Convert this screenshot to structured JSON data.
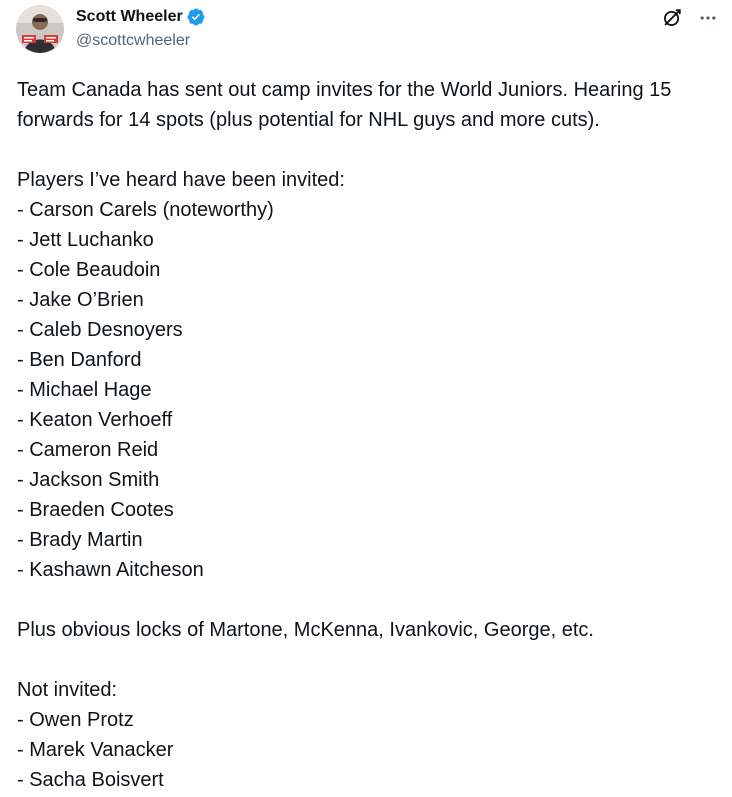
{
  "author": {
    "display_name": "Scott Wheeler",
    "handle": "@scottcwheeler",
    "verified": true,
    "avatar": "person-photo-avatar"
  },
  "actions": {
    "grok_icon": "slash-circle-icon",
    "more_icon": "more-horizontal-icon"
  },
  "colors": {
    "verified_badge": "#1d9bf0",
    "text_primary": "#0f1419",
    "text_secondary": "#536471"
  },
  "tweet": {
    "intro": [
      "Team Canada has sent out camp invites for the World Juniors. Hearing 15",
      "forwards for 14 spots (plus potential for NHL guys and more cuts)."
    ],
    "invited_heading": "Players I’ve heard have been invited:",
    "invited": [
      "- Carson Carels (noteworthy)",
      "- Jett Luchanko",
      "- Cole Beaudoin",
      "- Jake O’Brien",
      "- Caleb Desnoyers",
      "- Ben Danford",
      "- Michael Hage",
      "- Keaton Verhoeff",
      "- Cameron Reid",
      "- Jackson Smith",
      "- Braeden Cootes",
      "- Brady Martin",
      "- Kashawn Aitcheson"
    ],
    "locks": "Plus obvious locks of Martone, McKenna, Ivankovic, George, etc.",
    "not_invited_heading": "Not invited:",
    "not_invited": [
      "- Owen Protz",
      "- Marek Vanacker",
      "- Sacha Boisvert"
    ]
  }
}
